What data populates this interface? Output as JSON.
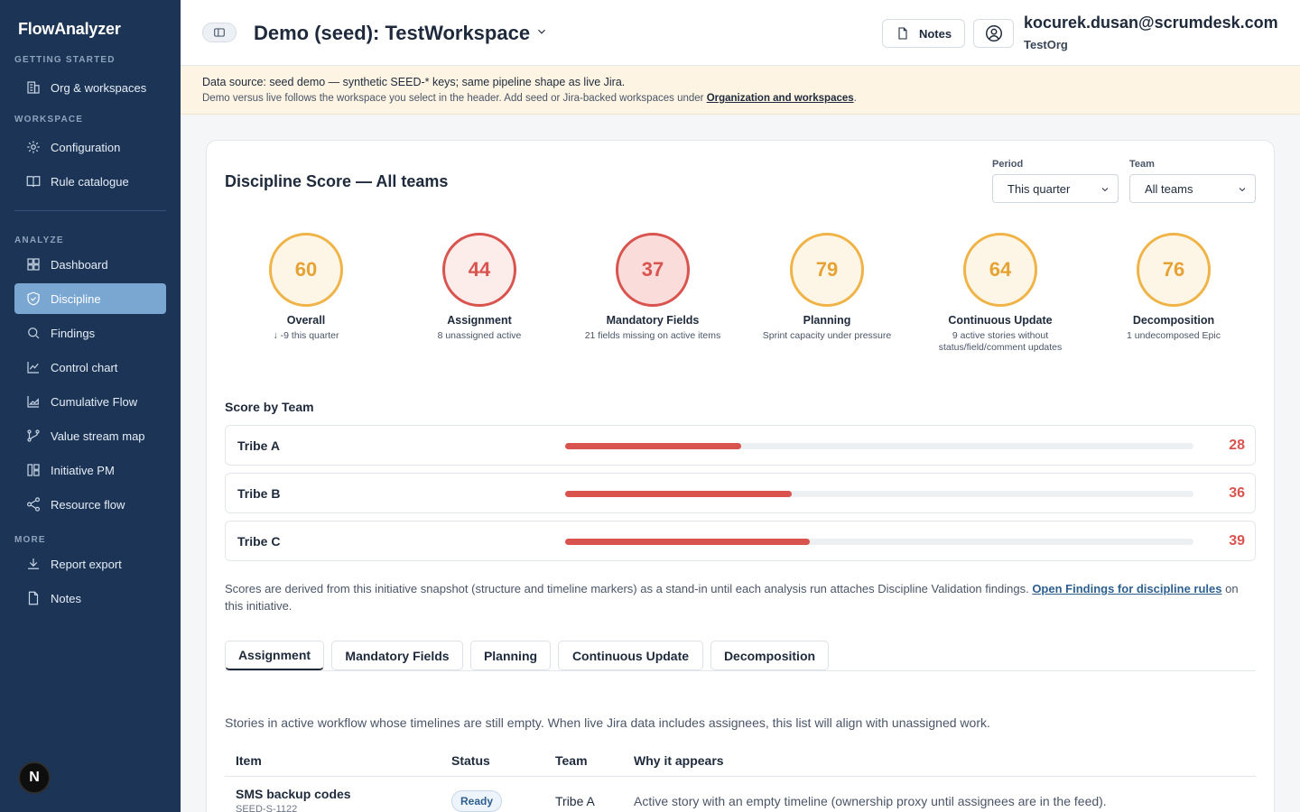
{
  "sidebar": {
    "brand": "FlowAnalyzer",
    "sections": {
      "getting_started": "GETTING STARTED",
      "workspace": "WORKSPACE",
      "analyze": "ANALYZE",
      "more": "MORE"
    },
    "items": {
      "org": "Org & workspaces",
      "configuration": "Configuration",
      "rules": "Rule catalogue",
      "dashboard": "Dashboard",
      "discipline": "Discipline",
      "findings": "Findings",
      "control_chart": "Control chart",
      "cfd": "Cumulative Flow",
      "vsm": "Value stream map",
      "initiative": "Initiative PM",
      "resource": "Resource flow",
      "export": "Report export",
      "notes": "Notes"
    },
    "badge": "N"
  },
  "header": {
    "workspace": "Demo (seed): TestWorkspace",
    "notes": "Notes",
    "email": "kocurek.dusan@scrumdesk.com",
    "org": "TestOrg"
  },
  "banner": {
    "line1": "Data source: seed demo — synthetic SEED-* keys; same pipeline shape as live Jira.",
    "line2": "Demo versus live follows the workspace you select in the header. Add seed or Jira-backed workspaces under",
    "link": "Organization and workspaces",
    "end": "."
  },
  "card": {
    "title": "Discipline Score — All teams",
    "period_label": "Period",
    "period_value": "This quarter",
    "team_label": "Team",
    "team_value": "All teams"
  },
  "scores": [
    {
      "value": "60",
      "name": "Overall",
      "sub": "↓ -9 this quarter"
    },
    {
      "value": "44",
      "name": "Assignment",
      "sub": "8 unassigned active"
    },
    {
      "value": "37",
      "name": "Mandatory Fields",
      "sub": "21 fields missing on active items"
    },
    {
      "value": "79",
      "name": "Planning",
      "sub": "Sprint capacity under pressure"
    },
    {
      "value": "64",
      "name": "Continuous Update",
      "sub": "9 active stories without status/field/comment updates"
    },
    {
      "value": "76",
      "name": "Decomposition",
      "sub": "1 undecomposed Epic"
    }
  ],
  "score_by_team": {
    "title": "Score by Team",
    "teams": [
      {
        "name": "Tribe A",
        "score": "28",
        "fraction": 0.28
      },
      {
        "name": "Tribe B",
        "score": "36",
        "fraction": 0.36
      },
      {
        "name": "Tribe C",
        "score": "39",
        "fraction": 0.39
      }
    ]
  },
  "explain": {
    "text": "Scores are derived from this initiative snapshot (structure and timeline markers) as a stand-in until each analysis run attaches Discipline Validation findings.",
    "link": "Open Findings for discipline rules",
    "end": "on this initiative."
  },
  "tabs": [
    "Assignment",
    "Mandatory Fields",
    "Planning",
    "Continuous Update",
    "Decomposition"
  ],
  "tab_content": {
    "description": "Stories in active workflow whose timelines are still empty. When live Jira data includes assignees, this list will align with unassigned work.",
    "columns": [
      "Item",
      "Status",
      "Team",
      "Why it appears"
    ],
    "rows": [
      {
        "item": "SMS backup codes",
        "key": "SEED-S-1122",
        "status": "Ready",
        "team": "Tribe A",
        "why": "Active story with an empty timeline (ownership proxy until assignees are in the feed)."
      }
    ]
  },
  "colors": {
    "sidebar_bg": "#1c3556",
    "active_nav": "#7aa7d2",
    "warning_ring": "#f0b347",
    "danger": "#d9534f",
    "banner_bg": "#fdf4e3"
  }
}
